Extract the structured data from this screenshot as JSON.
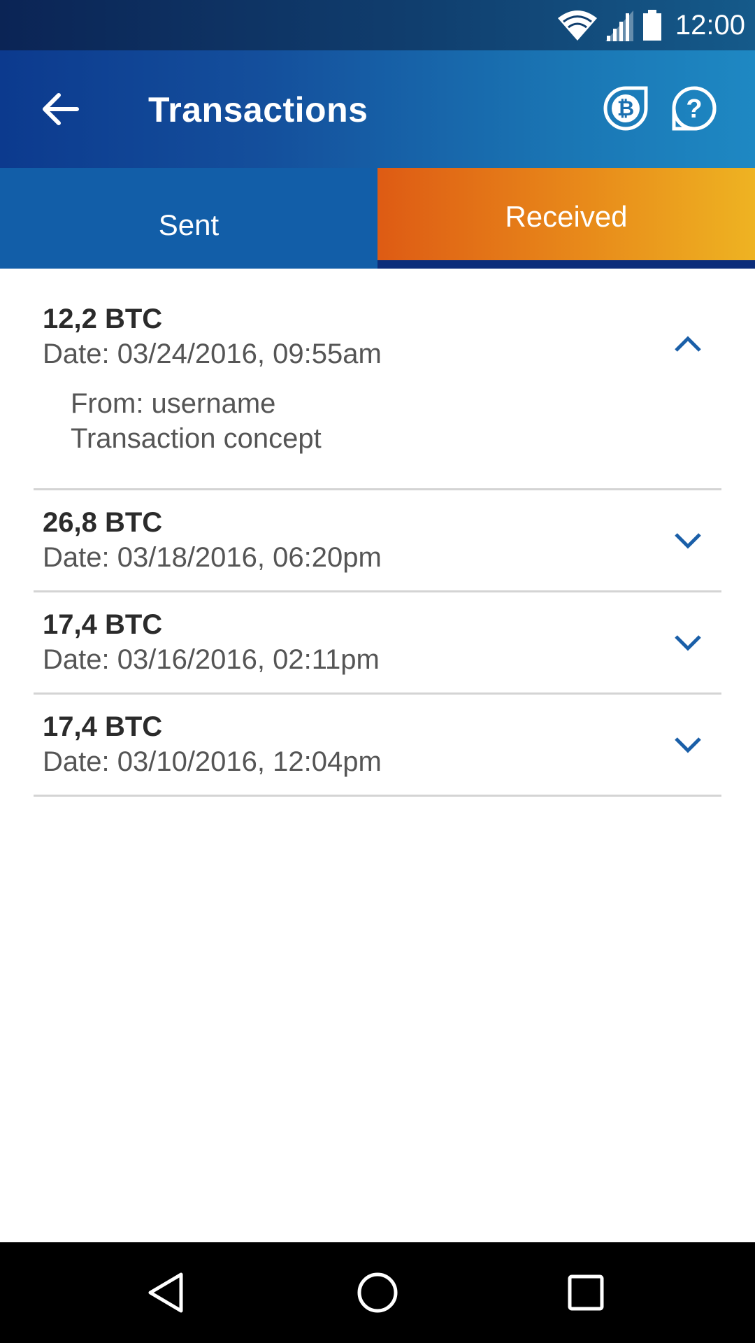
{
  "status_bar": {
    "time": "12:00"
  },
  "app_bar": {
    "title": "Transactions",
    "back_icon": "arrow-left-icon",
    "actions": [
      "bitcoin-icon",
      "help-icon"
    ]
  },
  "tabs": [
    {
      "label": "Sent",
      "selected": false
    },
    {
      "label": "Received",
      "selected": true
    }
  ],
  "transactions": [
    {
      "amount": "12,2 BTC",
      "date": "Date: 03/24/2016, 09:55am",
      "expanded": true,
      "from": "From: username",
      "concept": "Transaction concept"
    },
    {
      "amount": "26,8 BTC",
      "date": "Date: 03/18/2016, 06:20pm",
      "expanded": false
    },
    {
      "amount": "17,4 BTC",
      "date": "Date: 03/16/2016, 02:11pm",
      "expanded": false
    },
    {
      "amount": "17,4 BTC",
      "date": "Date: 03/10/2016, 12:04pm",
      "expanded": false
    }
  ],
  "colors": {
    "primary": "#125ea8",
    "accent_orange": "#e88a1a",
    "chevron": "#1a5fa8"
  },
  "nav_bar": {
    "icons": [
      "back-triangle-icon",
      "home-circle-icon",
      "recents-square-icon"
    ]
  }
}
